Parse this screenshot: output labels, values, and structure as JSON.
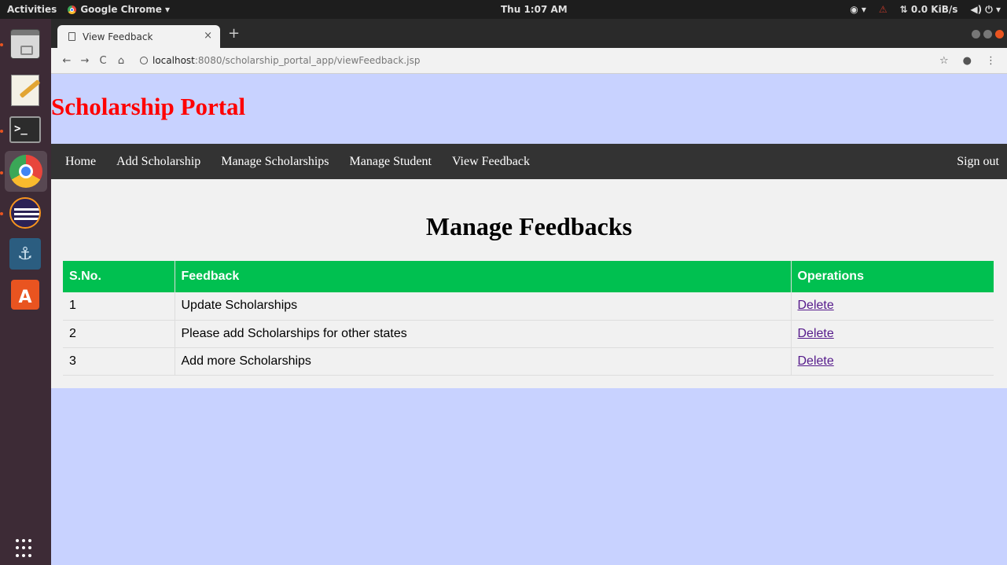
{
  "system_bar": {
    "activities": "Activities",
    "app_menu": "Google Chrome ▾",
    "clock": "Thu  1:07 AM",
    "network_speed": "⇅ 0.0 KiB/s",
    "accessibility": "◉ ▾",
    "volume": "◀) ⏻ ▾"
  },
  "dock": {
    "items": [
      "files-icon",
      "text-editor-icon",
      "terminal-icon",
      "chrome-icon",
      "eclipse-icon",
      "mysql-workbench-icon",
      "software-center-icon",
      "show-apps-icon"
    ]
  },
  "browser": {
    "tab_title": "View Feedback",
    "tab_close": "×",
    "new_tab": "+",
    "back": "←",
    "forward": "→",
    "reload": "C",
    "home": "⌂",
    "url_host": "localhost",
    "url_path": ":8080/scholarship_portal_app/viewFeedback.jsp",
    "bookmark": "☆",
    "profile": "●",
    "menu": "⋮"
  },
  "page": {
    "site_title": "Scholarship Portal",
    "nav": {
      "home": "Home",
      "add_scholarship": "Add Scholarship",
      "manage_scholarships": "Manage Scholarships",
      "manage_student": "Manage Student",
      "view_feedback": "View Feedback",
      "sign_out": "Sign out"
    },
    "heading": "Manage Feedbacks",
    "table": {
      "headers": [
        "S.No.",
        "Feedback",
        "Operations"
      ],
      "rows": [
        {
          "sno": "1",
          "feedback": "Update Scholarships",
          "operation": "Delete"
        },
        {
          "sno": "2",
          "feedback": "Please add Scholarships for other states",
          "operation": "Delete"
        },
        {
          "sno": "3",
          "feedback": "Add more Scholarships",
          "operation": "Delete"
        }
      ]
    }
  },
  "colors": {
    "page_background": "#c8d2ff",
    "title_red": "#ff0000",
    "navbar": "#333333",
    "table_header": "#00c050",
    "link": "#551a8b"
  }
}
